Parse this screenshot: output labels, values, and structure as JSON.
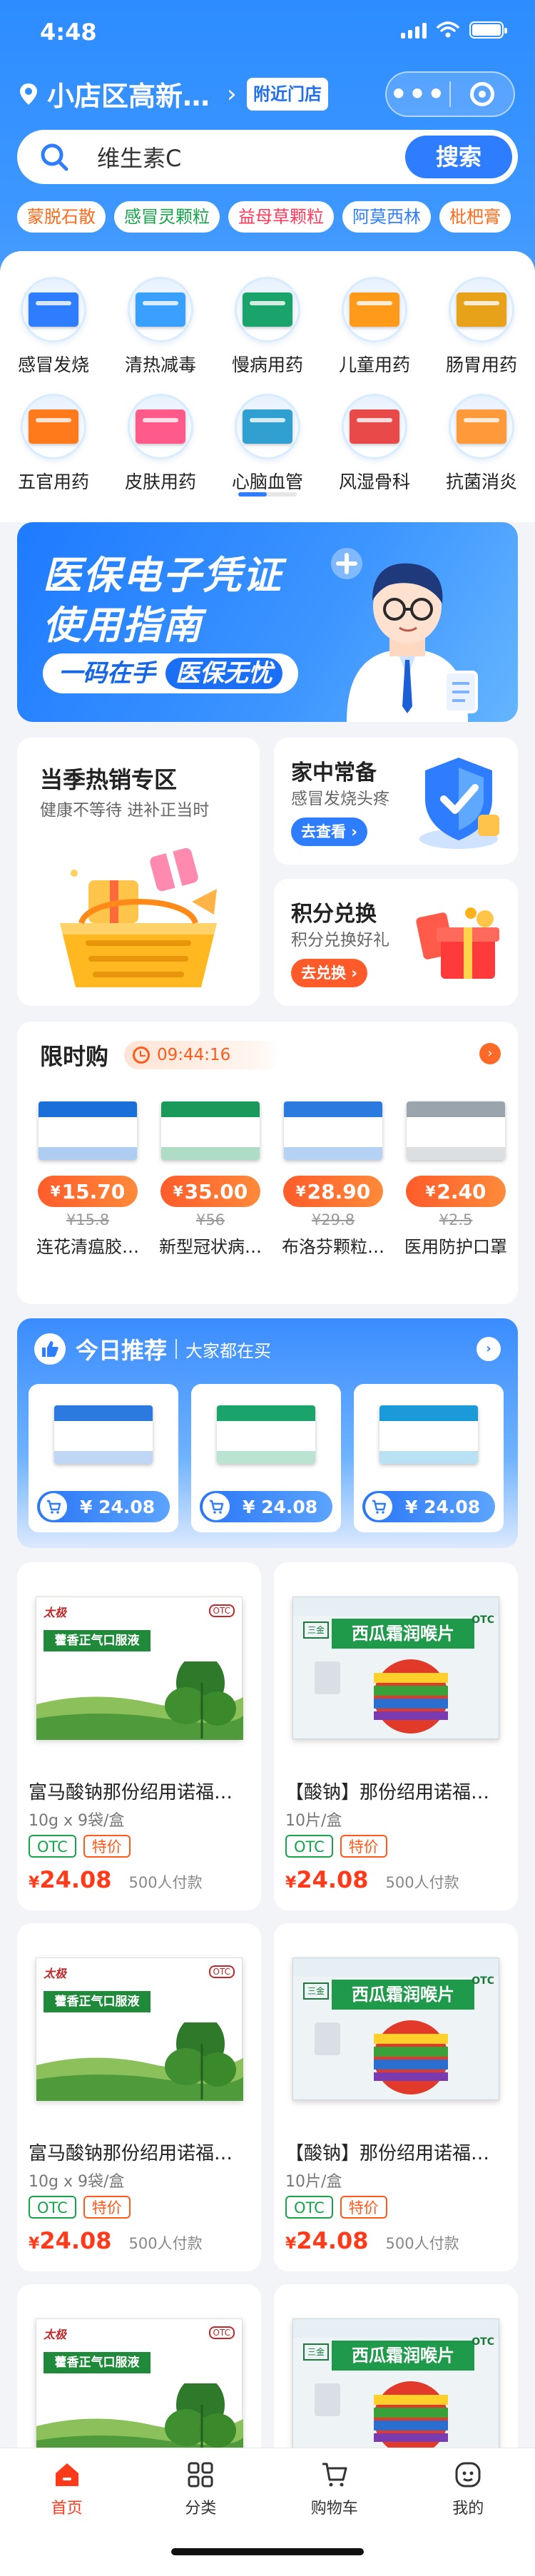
{
  "status": {
    "time": "4:48"
  },
  "header": {
    "location": "小店区高新…",
    "nearby_label": "附近门店"
  },
  "search": {
    "value": "维生素C",
    "button": "搜索"
  },
  "hot_tags": [
    {
      "label": "蒙脱石散",
      "color": "#ff6a1a"
    },
    {
      "label": "感冒灵颗粒",
      "color": "#16a34a"
    },
    {
      "label": "益母草颗粒",
      "color": "#ff3a5a"
    },
    {
      "label": "阿莫西林",
      "color": "#2f7dff"
    },
    {
      "label": "枇杷膏",
      "color": "#ff6a1a"
    }
  ],
  "categories": [
    {
      "label": "感冒发烧",
      "icon": "cold-medicine-icon",
      "color": "#2f7dff"
    },
    {
      "label": "清热减毒",
      "icon": "detox-medicine-icon",
      "color": "#3aa0ff"
    },
    {
      "label": "慢病用药",
      "icon": "chronic-medicine-icon",
      "color": "#1aa36a"
    },
    {
      "label": "儿童用药",
      "icon": "child-medicine-icon",
      "color": "#ff9a1a"
    },
    {
      "label": "肠胃用药",
      "icon": "stomach-medicine-icon",
      "color": "#e8a21a"
    },
    {
      "label": "五官用药",
      "icon": "facial-medicine-icon",
      "color": "#ff7a1a"
    },
    {
      "label": "皮肤用药",
      "icon": "skin-medicine-icon",
      "color": "#ff5a8a"
    },
    {
      "label": "心脑血管",
      "icon": "heart-medicine-icon",
      "color": "#2fa0d0"
    },
    {
      "label": "风湿骨科",
      "icon": "bone-medicine-icon",
      "color": "#e84a4a"
    },
    {
      "label": "抗菌消炎",
      "icon": "antibiotic-icon",
      "color": "#ff9a3a"
    }
  ],
  "banner": {
    "line1": "医保电子凭证",
    "line2": "使用指南",
    "pill_a": "一码在手",
    "pill_b": "医保无忧"
  },
  "hot_season": {
    "title": "当季热销专区",
    "subtitle": "健康不等待 进补正当时"
  },
  "home_stock": {
    "title": "家中常备",
    "subtitle": "感冒发烧头疼",
    "button": "去查看"
  },
  "points": {
    "title": "积分兑换",
    "subtitle": "积分兑换好礼",
    "button": "去兑换"
  },
  "flash_sale": {
    "title": "限时购",
    "countdown": "09:44:16",
    "items": [
      {
        "name": "连花清瘟胶…",
        "currency": "¥",
        "price": "15.70",
        "old": "¥15.8",
        "color": "#1a6fd8"
      },
      {
        "name": "新型冠状病…",
        "currency": "¥",
        "price": "35.00",
        "old": "¥56",
        "color": "#1a9a5a"
      },
      {
        "name": "布洛芬颗粒…",
        "currency": "¥",
        "price": "28.90",
        "old": "¥29.8",
        "color": "#2a7adf"
      },
      {
        "name": "医用防护口罩",
        "currency": "¥",
        "price": "2.40",
        "old": "¥2.5",
        "color": "#9aa4ad"
      }
    ]
  },
  "recommend": {
    "title": "今日推荐",
    "subtitle": "大家都在买",
    "items": [
      {
        "price": "¥ 24.08",
        "color": "#2a7adf"
      },
      {
        "price": "¥ 24.08",
        "color": "#1aa36a"
      },
      {
        "price": "¥ 24.08",
        "color": "#1a9ad8"
      }
    ]
  },
  "products": [
    {
      "title": "富马酸钠那份绍用诺福…",
      "spec": "10g x 9袋/盒",
      "tag1": "OTC",
      "tag2": "特价",
      "currency": "¥",
      "price": "24.08",
      "paid": "500人付款",
      "pack": 1
    },
    {
      "title": "【酸钠】那份绍用诺福…",
      "spec": "10片/盒",
      "tag1": "OTC",
      "tag2": "特价",
      "currency": "¥",
      "price": "24.08",
      "paid": "500人付款",
      "pack": 2
    },
    {
      "title": "富马酸钠那份绍用诺福…",
      "spec": "10g x 9袋/盒",
      "tag1": "OTC",
      "tag2": "特价",
      "currency": "¥",
      "price": "24.08",
      "paid": "500人付款",
      "pack": 1
    },
    {
      "title": "【酸钠】那份绍用诺福…",
      "spec": "10片/盒",
      "tag1": "OTC",
      "tag2": "特价",
      "currency": "¥",
      "price": "24.08",
      "paid": "500人付款",
      "pack": 2
    },
    {
      "title": "",
      "spec": "",
      "tag1": "",
      "tag2": "",
      "currency": "",
      "price": "",
      "paid": "",
      "pack": 1
    },
    {
      "title": "",
      "spec": "",
      "tag1": "",
      "tag2": "",
      "currency": "",
      "price": "",
      "paid": "",
      "pack": 2
    }
  ],
  "pack_text": {
    "brand1": "太极",
    "name1": "藿香正气口服液",
    "brand2": "三金",
    "name2": "西瓜霜润喉片",
    "otc": "OTC"
  },
  "tabbar": [
    {
      "label": "首页",
      "icon": "home-icon",
      "active": true
    },
    {
      "label": "分类",
      "icon": "category-icon",
      "active": false
    },
    {
      "label": "购物车",
      "icon": "cart-icon",
      "active": false
    },
    {
      "label": "我的",
      "icon": "profile-icon",
      "active": false
    }
  ]
}
